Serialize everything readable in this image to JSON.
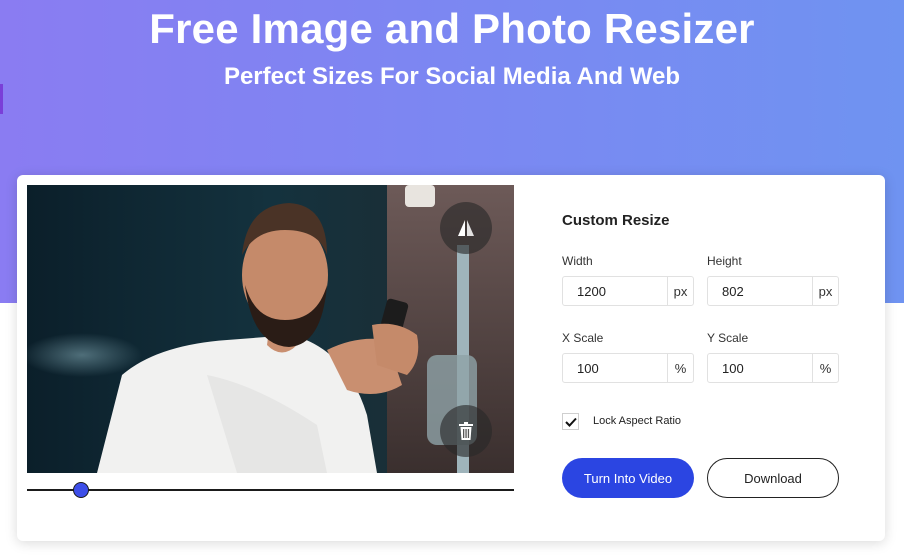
{
  "hero": {
    "title": "Free Image and Photo Resizer",
    "subtitle": "Perfect Sizes For Social Media And Web"
  },
  "preview": {
    "flip_icon": "flip-horizontal-icon",
    "delete_icon": "trash-icon",
    "zoom_fraction": 0.11
  },
  "resize": {
    "title": "Custom Resize",
    "width": {
      "label": "Width",
      "value": "1200",
      "unit": "px"
    },
    "height": {
      "label": "Height",
      "value": "802",
      "unit": "px"
    },
    "x_scale": {
      "label": "X Scale",
      "value": "100",
      "unit": "%"
    },
    "y_scale": {
      "label": "Y Scale",
      "value": "100",
      "unit": "%"
    },
    "lock_aspect": {
      "label": "Lock Aspect Ratio",
      "checked": true
    }
  },
  "actions": {
    "video_label": "Turn Into Video",
    "download_label": "Download"
  },
  "colors": {
    "accent": "#2b45e2",
    "hero_start": "#8a7cf2",
    "hero_end": "#6f93f1"
  }
}
